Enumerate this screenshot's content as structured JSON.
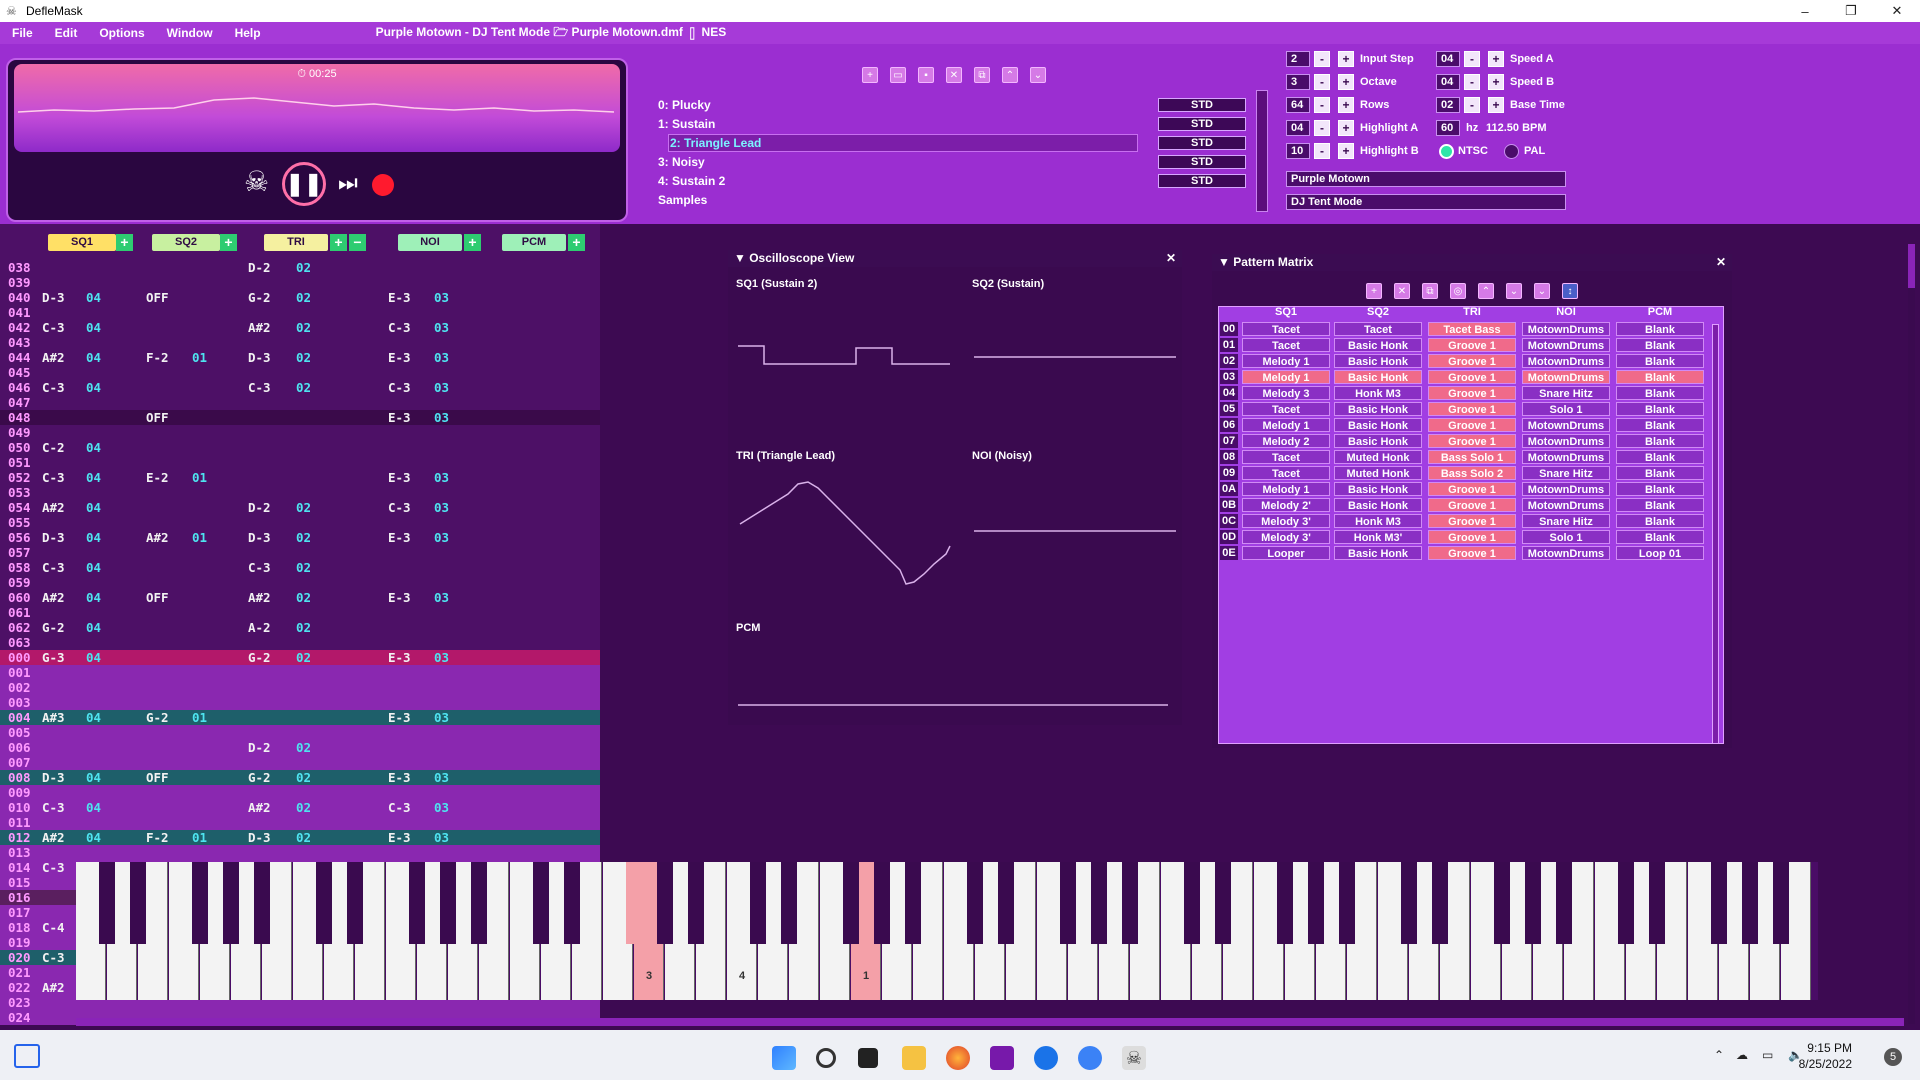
{
  "window": {
    "app_name": "DefleMask",
    "minimize": "–",
    "maximize": "❐",
    "close": "✕"
  },
  "menu": [
    "File",
    "Edit",
    "Options",
    "Window",
    "Help"
  ],
  "subtitle": "Purple Motown - DJ Tent Mode 🗁 Purple Motown.dmf ▯ NES",
  "player": {
    "time": "⏱ 00:25"
  },
  "instruments": [
    {
      "label": "0: Plucky",
      "mode": "STD"
    },
    {
      "label": "1: Sustain",
      "mode": "STD"
    },
    {
      "label": "2: Triangle Lead",
      "mode": "STD"
    },
    {
      "label": "3: Noisy",
      "mode": "STD"
    },
    {
      "label": "4: Sustain 2",
      "mode": "STD"
    }
  ],
  "samples_label": "Samples",
  "settings": {
    "input_step": {
      "value": "2",
      "label": "Input Step"
    },
    "octave": {
      "value": "3",
      "label": "Octave"
    },
    "rows": {
      "value": "64",
      "label": "Rows"
    },
    "highlight_a": {
      "value": "04",
      "label": "Highlight A"
    },
    "highlight_b": {
      "value": "10",
      "label": "Highlight B"
    },
    "speed_a": {
      "value": "04",
      "label": "Speed A"
    },
    "speed_b": {
      "value": "04",
      "label": "Speed B"
    },
    "base_time": {
      "value": "02",
      "label": "Base Time"
    },
    "hz": {
      "value": "60",
      "unit": "hz",
      "bpm": "112.50 BPM"
    },
    "ntsc": "NTSC",
    "pal": "PAL",
    "song_name": "Purple Motown",
    "author": "DJ Tent Mode",
    "minus": "-",
    "plus": "+"
  },
  "channels": [
    "SQ1",
    "SQ2",
    "TRI",
    "NOI",
    "PCM"
  ],
  "tracker_rows": [
    {
      "n": "038",
      "sq1": "",
      "sq1i": "",
      "sq2": "",
      "sq2i": "",
      "tri": "D-2",
      "trii": "02",
      "noi": "",
      "noii": ""
    },
    {
      "n": "039",
      "sq1": "",
      "sq1i": "",
      "sq2": "",
      "sq2i": "",
      "tri": "",
      "trii": "",
      "noi": "",
      "noii": ""
    },
    {
      "n": "040",
      "sq1": "D-3",
      "sq1i": "04",
      "sq2": "OFF",
      "sq2i": "",
      "tri": "G-2",
      "trii": "02",
      "noi": "E-3",
      "noii": "03"
    },
    {
      "n": "041",
      "sq1": "",
      "sq1i": "",
      "sq2": "",
      "sq2i": "",
      "tri": "",
      "trii": "",
      "noi": "",
      "noii": ""
    },
    {
      "n": "042",
      "sq1": "C-3",
      "sq1i": "04",
      "sq2": "",
      "sq2i": "",
      "tri": "A#2",
      "trii": "02",
      "noi": "C-3",
      "noii": "03"
    },
    {
      "n": "043",
      "sq1": "",
      "sq1i": "",
      "sq2": "",
      "sq2i": "",
      "tri": "",
      "trii": "",
      "noi": "",
      "noii": ""
    },
    {
      "n": "044",
      "sq1": "A#2",
      "sq1i": "04",
      "sq2": "F-2",
      "sq2i": "01",
      "tri": "D-3",
      "trii": "02",
      "noi": "E-3",
      "noii": "03"
    },
    {
      "n": "045",
      "sq1": "",
      "sq1i": "",
      "sq2": "",
      "sq2i": "",
      "tri": "",
      "trii": "",
      "noi": "",
      "noii": ""
    },
    {
      "n": "046",
      "sq1": "C-3",
      "sq1i": "04",
      "sq2": "",
      "sq2i": "",
      "tri": "C-3",
      "trii": "02",
      "noi": "C-3",
      "noii": "03"
    },
    {
      "n": "047",
      "sq1": "",
      "sq1i": "",
      "sq2": "",
      "sq2i": "",
      "tri": "",
      "trii": "",
      "noi": "",
      "noii": ""
    },
    {
      "n": "048",
      "sq1": "",
      "sq1i": "",
      "sq2": "OFF",
      "sq2i": "",
      "tri": "",
      "trii": "",
      "noi": "E-3",
      "noii": "03"
    },
    {
      "n": "049",
      "sq1": "",
      "sq1i": "",
      "sq2": "",
      "sq2i": "",
      "tri": "",
      "trii": "",
      "noi": "",
      "noii": ""
    },
    {
      "n": "050",
      "sq1": "C-2",
      "sq1i": "04",
      "sq2": "",
      "sq2i": "",
      "tri": "",
      "trii": "",
      "noi": "",
      "noii": ""
    },
    {
      "n": "051",
      "sq1": "",
      "sq1i": "",
      "sq2": "",
      "sq2i": "",
      "tri": "",
      "trii": "",
      "noi": "",
      "noii": ""
    },
    {
      "n": "052",
      "sq1": "C-3",
      "sq1i": "04",
      "sq2": "E-2",
      "sq2i": "01",
      "tri": "",
      "trii": "",
      "noi": "E-3",
      "noii": "03"
    },
    {
      "n": "053",
      "sq1": "",
      "sq1i": "",
      "sq2": "",
      "sq2i": "",
      "tri": "",
      "trii": "",
      "noi": "",
      "noii": ""
    },
    {
      "n": "054",
      "sq1": "A#2",
      "sq1i": "04",
      "sq2": "",
      "sq2i": "",
      "tri": "D-2",
      "trii": "02",
      "noi": "C-3",
      "noii": "03"
    },
    {
      "n": "055",
      "sq1": "",
      "sq1i": "",
      "sq2": "",
      "sq2i": "",
      "tri": "",
      "trii": "",
      "noi": "",
      "noii": ""
    },
    {
      "n": "056",
      "sq1": "D-3",
      "sq1i": "04",
      "sq2": "A#2",
      "sq2i": "01",
      "tri": "D-3",
      "trii": "02",
      "noi": "E-3",
      "noii": "03"
    },
    {
      "n": "057",
      "sq1": "",
      "sq1i": "",
      "sq2": "",
      "sq2i": "",
      "tri": "",
      "trii": "",
      "noi": "",
      "noii": ""
    },
    {
      "n": "058",
      "sq1": "C-3",
      "sq1i": "04",
      "sq2": "",
      "sq2i": "",
      "tri": "C-3",
      "trii": "02",
      "noi": "",
      "noii": ""
    },
    {
      "n": "059",
      "sq1": "",
      "sq1i": "",
      "sq2": "",
      "sq2i": "",
      "tri": "",
      "trii": "",
      "noi": "",
      "noii": ""
    },
    {
      "n": "060",
      "sq1": "A#2",
      "sq1i": "04",
      "sq2": "OFF",
      "sq2i": "",
      "tri": "A#2",
      "trii": "02",
      "noi": "E-3",
      "noii": "03"
    },
    {
      "n": "061",
      "sq1": "",
      "sq1i": "",
      "sq2": "",
      "sq2i": "",
      "tri": "",
      "trii": "",
      "noi": "",
      "noii": ""
    },
    {
      "n": "062",
      "sq1": "G-2",
      "sq1i": "04",
      "sq2": "",
      "sq2i": "",
      "tri": "A-2",
      "trii": "02",
      "noi": "",
      "noii": ""
    },
    {
      "n": "063",
      "sq1": "",
      "sq1i": "",
      "sq2": "",
      "sq2i": "",
      "tri": "",
      "trii": "",
      "noi": "",
      "noii": ""
    },
    {
      "n": "000",
      "sq1": "G-3",
      "sq1i": "04",
      "sq2": "",
      "sq2i": "",
      "tri": "G-2",
      "trii": "02",
      "noi": "E-3",
      "noii": "03"
    },
    {
      "n": "001",
      "sq1": "",
      "sq1i": "",
      "sq2": "",
      "sq2i": "",
      "tri": "",
      "trii": "",
      "noi": "",
      "noii": ""
    },
    {
      "n": "002",
      "sq1": "",
      "sq1i": "",
      "sq2": "",
      "sq2i": "",
      "tri": "",
      "trii": "",
      "noi": "",
      "noii": ""
    },
    {
      "n": "003",
      "sq1": "",
      "sq1i": "",
      "sq2": "",
      "sq2i": "",
      "tri": "",
      "trii": "",
      "noi": "",
      "noii": ""
    },
    {
      "n": "004",
      "sq1": "A#3",
      "sq1i": "04",
      "sq2": "G-2",
      "sq2i": "01",
      "tri": "",
      "trii": "",
      "noi": "E-3",
      "noii": "03"
    },
    {
      "n": "005",
      "sq1": "",
      "sq1i": "",
      "sq2": "",
      "sq2i": "",
      "tri": "",
      "trii": "",
      "noi": "",
      "noii": ""
    },
    {
      "n": "006",
      "sq1": "",
      "sq1i": "",
      "sq2": "",
      "sq2i": "",
      "tri": "D-2",
      "trii": "02",
      "noi": "",
      "noii": ""
    },
    {
      "n": "007",
      "sq1": "",
      "sq1i": "",
      "sq2": "",
      "sq2i": "",
      "tri": "",
      "trii": "",
      "noi": "",
      "noii": ""
    },
    {
      "n": "008",
      "sq1": "D-3",
      "sq1i": "04",
      "sq2": "OFF",
      "sq2i": "",
      "tri": "G-2",
      "trii": "02",
      "noi": "E-3",
      "noii": "03"
    },
    {
      "n": "009",
      "sq1": "",
      "sq1i": "",
      "sq2": "",
      "sq2i": "",
      "tri": "",
      "trii": "",
      "noi": "",
      "noii": ""
    },
    {
      "n": "010",
      "sq1": "C-3",
      "sq1i": "04",
      "sq2": "",
      "sq2i": "",
      "tri": "A#2",
      "trii": "02",
      "noi": "C-3",
      "noii": "03"
    },
    {
      "n": "011",
      "sq1": "",
      "sq1i": "",
      "sq2": "",
      "sq2i": "",
      "tri": "",
      "trii": "",
      "noi": "",
      "noii": ""
    },
    {
      "n": "012",
      "sq1": "A#2",
      "sq1i": "04",
      "sq2": "F-2",
      "sq2i": "01",
      "tri": "D-3",
      "trii": "02",
      "noi": "E-3",
      "noii": "03"
    },
    {
      "n": "013",
      "sq1": "",
      "sq1i": "",
      "sq2": "",
      "sq2i": "",
      "tri": "",
      "trii": "",
      "noi": "",
      "noii": ""
    },
    {
      "n": "014",
      "sq1": "C-3",
      "sq1i": "",
      "sq2": "",
      "sq2i": "",
      "tri": "",
      "trii": "",
      "noi": "",
      "noii": ""
    },
    {
      "n": "015",
      "sq1": "",
      "sq1i": "",
      "sq2": "",
      "sq2i": "",
      "tri": "",
      "trii": "",
      "noi": "",
      "noii": ""
    },
    {
      "n": "016",
      "sq1": "",
      "sq1i": "",
      "sq2": "",
      "sq2i": "",
      "tri": "",
      "trii": "",
      "noi": "",
      "noii": ""
    },
    {
      "n": "017",
      "sq1": "",
      "sq1i": "",
      "sq2": "",
      "sq2i": "",
      "tri": "",
      "trii": "",
      "noi": "",
      "noii": ""
    },
    {
      "n": "018",
      "sq1": "C-4",
      "sq1i": "",
      "sq2": "",
      "sq2i": "",
      "tri": "",
      "trii": "",
      "noi": "",
      "noii": ""
    },
    {
      "n": "019",
      "sq1": "",
      "sq1i": "",
      "sq2": "",
      "sq2i": "",
      "tri": "",
      "trii": "",
      "noi": "",
      "noii": ""
    },
    {
      "n": "020",
      "sq1": "C-3",
      "sq1i": "",
      "sq2": "",
      "sq2i": "",
      "tri": "",
      "trii": "",
      "noi": "",
      "noii": ""
    },
    {
      "n": "021",
      "sq1": "",
      "sq1i": "",
      "sq2": "",
      "sq2i": "",
      "tri": "",
      "trii": "",
      "noi": "",
      "noii": ""
    },
    {
      "n": "022",
      "sq1": "A#2",
      "sq1i": "",
      "sq2": "",
      "sq2i": "",
      "tri": "",
      "trii": "",
      "noi": "",
      "noii": ""
    },
    {
      "n": "023",
      "sq1": "",
      "sq1i": "",
      "sq2": "",
      "sq2i": "",
      "tri": "",
      "trii": "",
      "noi": "",
      "noii": ""
    },
    {
      "n": "024",
      "sq1": "",
      "sq1i": "",
      "sq2": "",
      "sq2i": "",
      "tri": "",
      "trii": "",
      "noi": "",
      "noii": ""
    }
  ],
  "oscilloscope": {
    "title": "Oscilloscope View",
    "labels": [
      "SQ1 (Sustain 2)",
      "SQ2 (Sustain)",
      "TRI (Triangle Lead)",
      "NOI (Noisy)",
      "PCM"
    ]
  },
  "pattern_matrix": {
    "title": "Pattern Matrix",
    "columns": [
      "SQ1",
      "SQ2",
      "TRI",
      "NOI",
      "PCM"
    ],
    "rows": [
      {
        "id": "00",
        "cells": [
          "Tacet",
          "Tacet",
          "Tacet Bass",
          "MotownDrums",
          "Blank"
        ]
      },
      {
        "id": "01",
        "cells": [
          "Tacet",
          "Basic Honk",
          "Groove 1",
          "MotownDrums",
          "Blank"
        ]
      },
      {
        "id": "02",
        "cells": [
          "Melody 1",
          "Basic Honk",
          "Groove 1",
          "MotownDrums",
          "Blank"
        ]
      },
      {
        "id": "03",
        "cells": [
          "Melody 1",
          "Basic Honk",
          "Groove 1",
          "MotownDrums",
          "Blank"
        ]
      },
      {
        "id": "04",
        "cells": [
          "Melody 3",
          "Honk M3",
          "Groove 1",
          "Snare Hitz",
          "Blank"
        ]
      },
      {
        "id": "05",
        "cells": [
          "Tacet",
          "Basic Honk",
          "Groove 1",
          "Solo 1",
          "Blank"
        ]
      },
      {
        "id": "06",
        "cells": [
          "Melody 1",
          "Basic Honk",
          "Groove 1",
          "MotownDrums",
          "Blank"
        ]
      },
      {
        "id": "07",
        "cells": [
          "Melody 2",
          "Basic Honk",
          "Groove 1",
          "MotownDrums",
          "Blank"
        ]
      },
      {
        "id": "08",
        "cells": [
          "Tacet",
          "Muted Honk",
          "Bass Solo 1",
          "MotownDrums",
          "Blank"
        ]
      },
      {
        "id": "09",
        "cells": [
          "Tacet",
          "Muted Honk",
          "Bass Solo 2",
          "Snare Hitz",
          "Blank"
        ]
      },
      {
        "id": "0A",
        "cells": [
          "Melody 1",
          "Basic Honk",
          "Groove 1",
          "MotownDrums",
          "Blank"
        ]
      },
      {
        "id": "0B",
        "cells": [
          "Melody 2'",
          "Basic Honk",
          "Groove 1",
          "MotownDrums",
          "Blank"
        ]
      },
      {
        "id": "0C",
        "cells": [
          "Melody 3'",
          "Honk M3",
          "Groove 1",
          "Snare Hitz",
          "Blank"
        ]
      },
      {
        "id": "0D",
        "cells": [
          "Melody 3'",
          "Honk M3'",
          "Groove 1",
          "Solo 1",
          "Blank"
        ]
      },
      {
        "id": "0E",
        "cells": [
          "Looper",
          "Basic Honk",
          "Groove 1",
          "MotownDrums",
          "Loop 01"
        ]
      }
    ]
  },
  "piano_labels": {
    "a": "3",
    "b": "4",
    "c": "1"
  },
  "taskbar": {
    "time": "9:15 PM",
    "date": "8/25/2022",
    "badge": "5"
  },
  "colors": {
    "accent": "#9b2ed1",
    "play_cursor": "#c2185b",
    "cyan": "#4ee4f0"
  }
}
